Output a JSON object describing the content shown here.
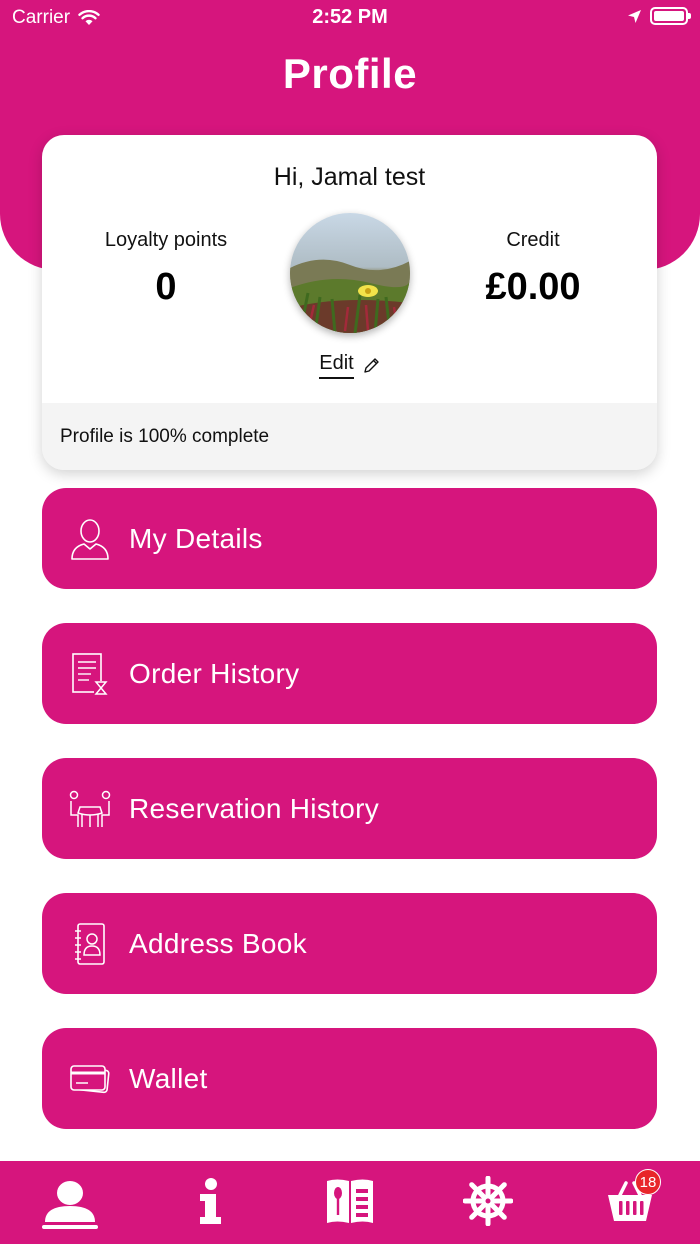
{
  "status_bar": {
    "carrier": "Carrier",
    "time": "2:52 PM"
  },
  "header": {
    "title": "Profile"
  },
  "profile": {
    "greeting": "Hi, Jamal test",
    "loyalty_label": "Loyalty points",
    "loyalty_value": "0",
    "credit_label": "Credit",
    "credit_value": "£0.00",
    "edit_label": "Edit",
    "completion_text": "Profile is 100% complete"
  },
  "menu": [
    {
      "label": "My Details",
      "icon": "person-icon"
    },
    {
      "label": "Order History",
      "icon": "order-history-icon"
    },
    {
      "label": "Reservation History",
      "icon": "reservation-icon"
    },
    {
      "label": "Address Book",
      "icon": "address-book-icon"
    },
    {
      "label": "Wallet",
      "icon": "wallet-icon"
    }
  ],
  "tab_bar": {
    "tabs": [
      "profile-tab",
      "info-tab",
      "menu-tab",
      "settings-tab",
      "basket-tab"
    ],
    "basket_badge": "18"
  },
  "colors": {
    "brand": "#d6157d",
    "badge": "#e8262a"
  }
}
